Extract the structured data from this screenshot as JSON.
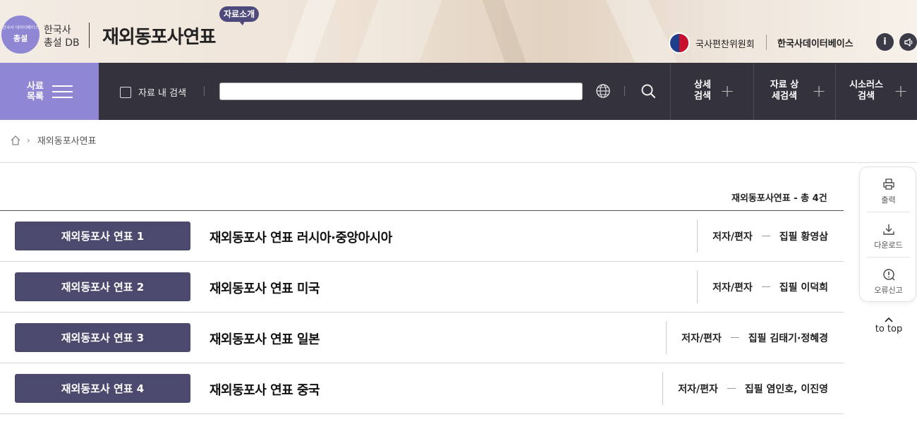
{
  "header": {
    "logo": {
      "small_text": "한국사 데이터베이스",
      "mid_text": "총설",
      "title_line1": "한국사",
      "title_line2": "총설 DB"
    },
    "site_title": "재외동포사연표",
    "intro_badge": "자료소개",
    "org_label": "국사편찬위원회",
    "db_link": "한국사데이터베이스",
    "info_icon": "i",
    "sound_icon": "speaker-icon"
  },
  "nav": {
    "menu_label": "사료 목록",
    "checkbox_label": "자료 내 검색",
    "search_value": "",
    "cols": [
      {
        "label": "상세 검색"
      },
      {
        "label": "자료 상세검색"
      },
      {
        "label": "시소러스 검색"
      }
    ]
  },
  "breadcrumb": {
    "current": "재외동포사연표"
  },
  "list": {
    "summary": "재외동포사연표 - 총 4건",
    "rows": [
      {
        "button": "재외동포사 연표 1",
        "title": "재외동포사 연표 러시아·중앙아시아",
        "meta_key": "저자/편자",
        "meta_value": "집필 황영삼"
      },
      {
        "button": "재외동포사 연표 2",
        "title": "재외동포사 연표 미국",
        "meta_key": "저자/편자",
        "meta_value": "집필 이덕희"
      },
      {
        "button": "재외동포사 연표 3",
        "title": "재외동포사 연표 일본",
        "meta_key": "저자/편자",
        "meta_value": "집필 김태기·정혜경"
      },
      {
        "button": "재외동포사 연표 4",
        "title": "재외동포사 연표 중국",
        "meta_key": "저자/편자",
        "meta_value": "집필 염인호, 이진영"
      }
    ]
  },
  "side_tools": {
    "print": "출력",
    "download": "다운로드",
    "report": "오류신고",
    "to_top": "to top"
  },
  "colors": {
    "accent_purple": "#8f86d4",
    "nav_dark": "#33323d",
    "button_navy": "#4b4a6e"
  }
}
